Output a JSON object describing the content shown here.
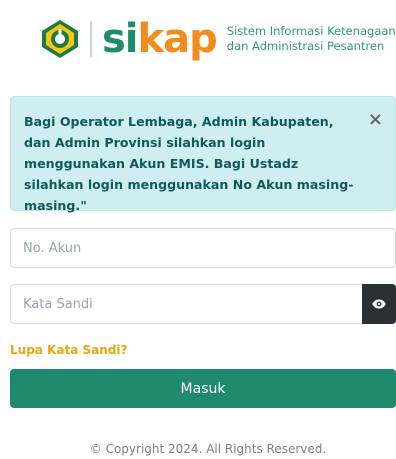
{
  "header": {
    "brand_part1": "si",
    "brand_part2": "kap",
    "tagline_line1": "Sistem Informasi Ketenagaan",
    "tagline_line2": "dan Administrasi Pesantren",
    "emblem_icon": "kemenag-emblem-icon"
  },
  "alert": {
    "message": "Bagi Operator Lembaga, Admin Kabupaten, dan Admin Provinsi silahkan login menggunakan Akun EMIS. Bagi Ustadz silahkan login menggunakan No Akun masing-masing.\"",
    "close_label": "×"
  },
  "form": {
    "account_placeholder": "No. Akun",
    "password_placeholder": "Kata Sandi",
    "show_password_icon": "eye-icon",
    "forgot_password_label": "Lupa Kata Sandi?",
    "submit_label": "Masuk"
  },
  "footer": {
    "copyright": "© Copyright 2024. All Rights Reserved."
  },
  "colors": {
    "primary": "#1f8a6e",
    "accent_orange": "#f28c1e",
    "alert_bg": "#cfeef0",
    "alert_text": "#0f5a5f",
    "link": "#f2a20c"
  }
}
